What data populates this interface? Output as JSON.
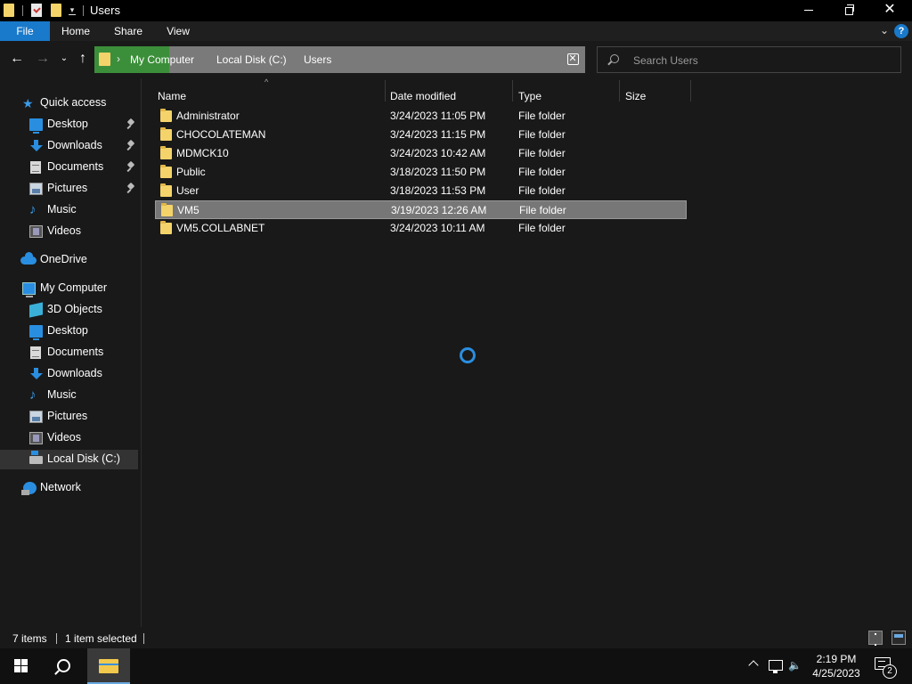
{
  "window": {
    "title": "Users",
    "caption": {
      "close_glyph": "✕"
    }
  },
  "ribbon": {
    "tabs": [
      {
        "label": "File",
        "active": true
      },
      {
        "label": "Home"
      },
      {
        "label": "Share"
      },
      {
        "label": "View"
      }
    ],
    "help_glyph": "?"
  },
  "address": {
    "breadcrumbs": [
      "My Computer",
      "Local Disk (C:)",
      "Users"
    ]
  },
  "search": {
    "placeholder": "Search Users"
  },
  "nav": {
    "quick_access": "Quick access",
    "qa_items": [
      {
        "label": "Desktop",
        "icon": "desktop-icon",
        "pinned": true
      },
      {
        "label": "Downloads",
        "icon": "downloads-icon",
        "pinned": true
      },
      {
        "label": "Documents",
        "icon": "documents-icon",
        "pinned": true
      },
      {
        "label": "Pictures",
        "icon": "pictures-icon",
        "pinned": true
      },
      {
        "label": "Music",
        "icon": "music-icon"
      },
      {
        "label": "Videos",
        "icon": "videos-icon"
      }
    ],
    "onedrive": "OneDrive",
    "this_pc": "My Computer",
    "pc_items": [
      {
        "label": "3D Objects",
        "icon": "3d-objects-icon"
      },
      {
        "label": "Desktop",
        "icon": "desktop-icon"
      },
      {
        "label": "Documents",
        "icon": "documents-icon"
      },
      {
        "label": "Downloads",
        "icon": "downloads-icon"
      },
      {
        "label": "Music",
        "icon": "music-icon"
      },
      {
        "label": "Pictures",
        "icon": "pictures-icon"
      },
      {
        "label": "Videos",
        "icon": "videos-icon"
      },
      {
        "label": "Local Disk (C:)",
        "icon": "drive-icon",
        "selected": true
      }
    ],
    "network": "Network"
  },
  "columns": {
    "name": "Name",
    "date": "Date modified",
    "type": "Type",
    "size": "Size"
  },
  "files": [
    {
      "name": "Administrator",
      "date": "3/24/2023 11:05 PM",
      "type": "File folder",
      "size": ""
    },
    {
      "name": "CHOCOLATEMAN",
      "date": "3/24/2023 11:15 PM",
      "type": "File folder",
      "size": ""
    },
    {
      "name": "MDMCK10",
      "date": "3/24/2023 10:42 AM",
      "type": "File folder",
      "size": ""
    },
    {
      "name": "Public",
      "date": "3/18/2023 11:50 PM",
      "type": "File folder",
      "size": ""
    },
    {
      "name": "User",
      "date": "3/18/2023 11:53 PM",
      "type": "File folder",
      "size": ""
    },
    {
      "name": "VM5",
      "date": "3/19/2023 12:26 AM",
      "type": "File folder",
      "size": "",
      "selected": true
    },
    {
      "name": "VM5.COLLABNET",
      "date": "3/24/2023 10:11 AM",
      "type": "File folder",
      "size": ""
    }
  ],
  "status": {
    "item_count": "7 items",
    "selection": "1 item selected"
  },
  "taskbar": {
    "time": "2:19 PM",
    "date": "4/25/2023",
    "notification_count": "2"
  },
  "colors": {
    "file_tab": "#1979ca",
    "address_highlight": "#3c8f3a",
    "folder": "#f5d36b",
    "selection": "#777777",
    "accent": "#2a8ee0"
  }
}
